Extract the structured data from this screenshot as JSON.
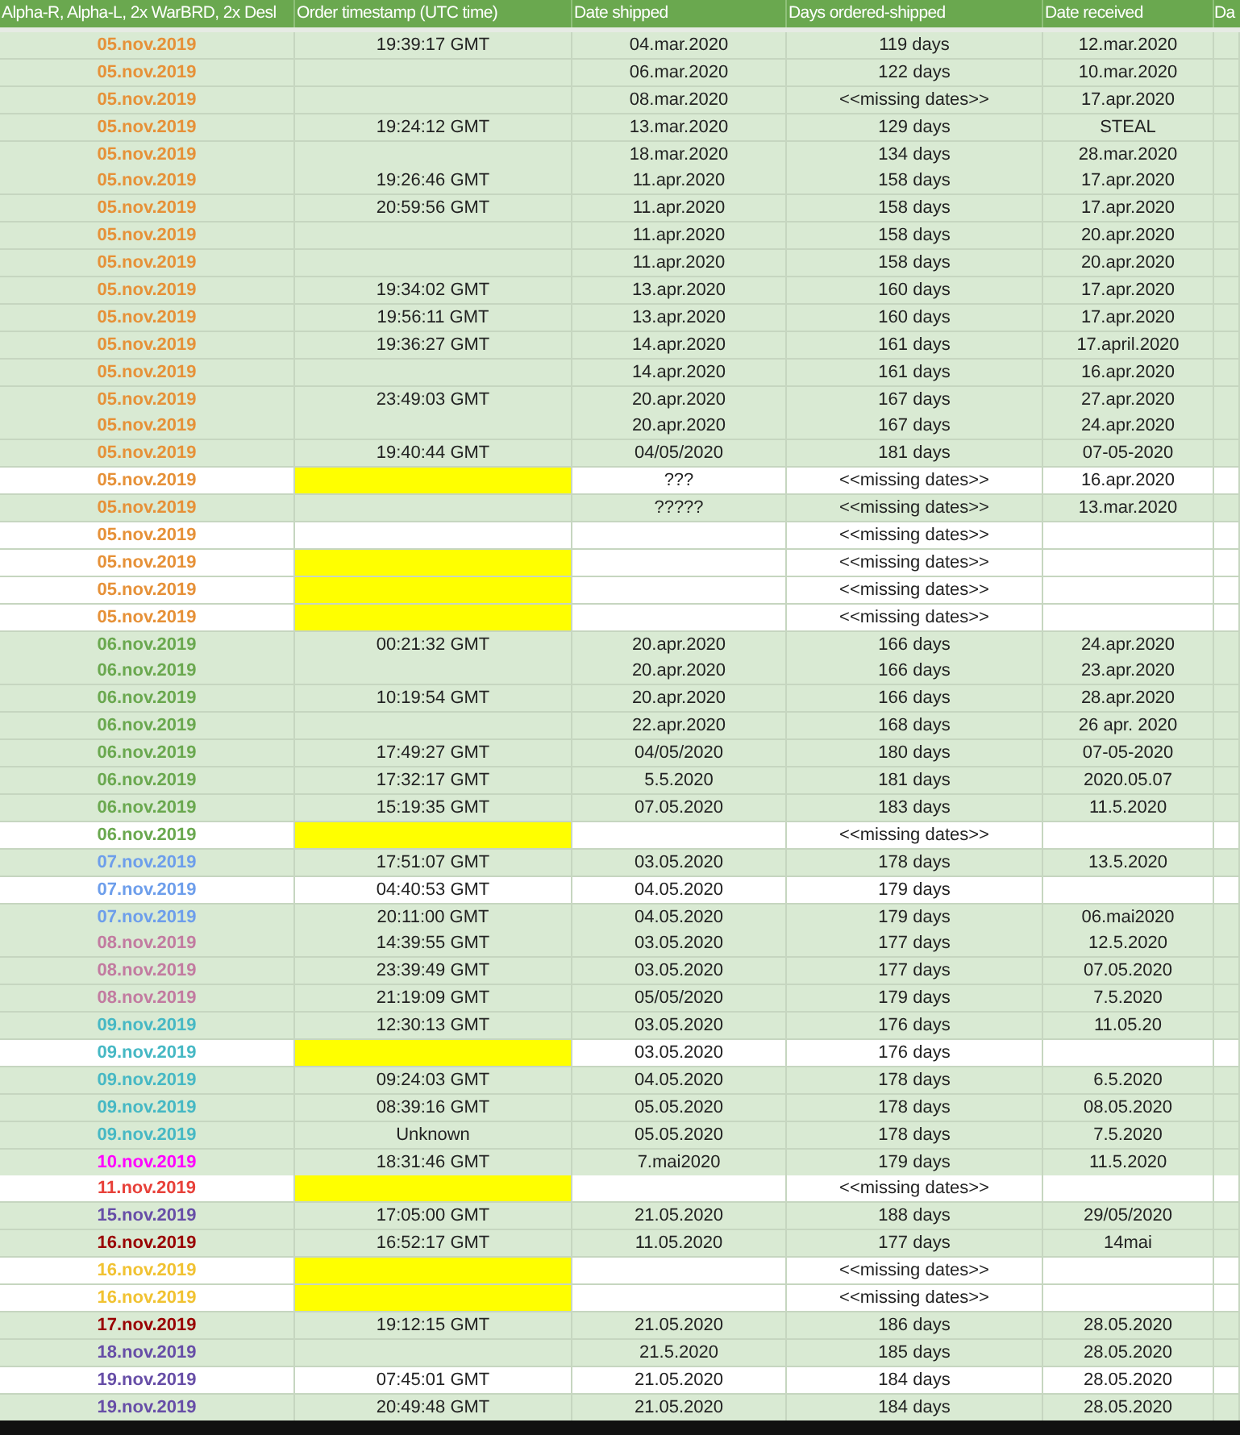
{
  "columns": [
    "Alpha-R, Alpha-L, 2x WarBRD, 2x Desl",
    "Order timestamp (UTC time)",
    "Date shipped",
    "Days ordered-shipped",
    "Date received",
    "Da"
  ],
  "rows": [
    {
      "kind": "green",
      "date": "05.nov.2019",
      "color": "#e69138",
      "time": "19:39:17 GMT",
      "flagged": false,
      "shipped": "04.mar.2020",
      "days": "119 days",
      "received": "12.mar.2020"
    },
    {
      "kind": "green",
      "date": "05.nov.2019",
      "color": "#e69138",
      "flagged": false,
      "shipped": "06.mar.2020",
      "days": "122 days",
      "received": "10.mar.2020"
    },
    {
      "kind": "green",
      "date": "05.nov.2019",
      "color": "#e69138",
      "flagged": false,
      "shipped": "08.mar.2020",
      "days": "<<missing dates>>",
      "received": "17.apr.2020"
    },
    {
      "kind": "green",
      "date": "05.nov.2019",
      "color": "#e69138",
      "time": "19:24:12 GMT",
      "flagged": false,
      "shipped": "13.mar.2020",
      "days": "129 days",
      "received": "STEAL"
    },
    {
      "kind": "green",
      "date": "05.nov.2019",
      "color": "#e69138",
      "flagged": false,
      "shipped": "18.mar.2020",
      "days": "134 days",
      "received": "28.mar.2020"
    },
    {
      "kind": "green",
      "date": "05.nov.2019",
      "color": "#e69138",
      "time": "19:26:46 GMT",
      "flagged": false,
      "shipped": "11.apr.2020",
      "days": "158 days",
      "received": "17.apr.2020"
    },
    {
      "kind": "green",
      "date": "05.nov.2019",
      "color": "#e69138",
      "time": "20:59:56 GMT",
      "flagged": false,
      "shipped": "11.apr.2020",
      "days": "158 days",
      "received": "17.apr.2020"
    },
    {
      "kind": "green",
      "date": "05.nov.2019",
      "color": "#e69138",
      "flagged": false,
      "shipped": "11.apr.2020",
      "days": "158 days",
      "received": "20.apr.2020"
    },
    {
      "kind": "green",
      "date": "05.nov.2019",
      "color": "#e69138",
      "flagged": false,
      "shipped": "11.apr.2020",
      "days": "158 days",
      "received": "20.apr.2020"
    },
    {
      "kind": "green",
      "date": "05.nov.2019",
      "color": "#e69138",
      "time": "19:34:02 GMT",
      "flagged": false,
      "shipped": "13.apr.2020",
      "days": "160 days",
      "received": "17.apr.2020"
    },
    {
      "kind": "green",
      "date": "05.nov.2019",
      "color": "#e69138",
      "time": "19:56:11 GMT",
      "flagged": false,
      "shipped": "13.apr.2020",
      "days": "160 days",
      "received": "17.apr.2020"
    },
    {
      "kind": "green",
      "date": "05.nov.2019",
      "color": "#e69138",
      "time": "19:36:27 GMT",
      "flagged": false,
      "shipped": "14.apr.2020",
      "days": "161 days",
      "received": "17.april.2020"
    },
    {
      "kind": "green",
      "date": "05.nov.2019",
      "color": "#e69138",
      "flagged": false,
      "shipped": "14.apr.2020",
      "days": "161 days",
      "received": "16.apr.2020"
    },
    {
      "kind": "green",
      "date": "05.nov.2019",
      "color": "#e69138",
      "time": "23:49:03 GMT",
      "flagged": false,
      "shipped": "20.apr.2020",
      "days": "167 days",
      "received": "27.apr.2020"
    },
    {
      "kind": "green",
      "date": "05.nov.2019",
      "color": "#e69138",
      "flagged": false,
      "shipped": "20.apr.2020",
      "days": "167 days",
      "received": "24.apr.2020"
    },
    {
      "kind": "green",
      "date": "05.nov.2019",
      "color": "#e69138",
      "time": "19:40:44 GMT",
      "flagged": false,
      "shipped": "04/05/2020",
      "days": "181 days",
      "received": "07-05-2020"
    },
    {
      "kind": "white",
      "date": "05.nov.2019",
      "color": "#e69138",
      "flagged": true,
      "shipped": "???",
      "days": "<<missing dates>>",
      "received": "16.apr.2020"
    },
    {
      "kind": "green",
      "date": "05.nov.2019",
      "color": "#e69138",
      "flagged": false,
      "shipped": "?????",
      "days": "<<missing dates>>",
      "received": "13.mar.2020"
    },
    {
      "kind": "white",
      "date": "05.nov.2019",
      "color": "#e69138",
      "flagged": false,
      "days": "<<missing dates>>"
    },
    {
      "kind": "white",
      "date": "05.nov.2019",
      "color": "#e69138",
      "flagged": true,
      "days": "<<missing dates>>"
    },
    {
      "kind": "white",
      "date": "05.nov.2019",
      "color": "#e69138",
      "flagged": true,
      "days": "<<missing dates>>"
    },
    {
      "kind": "white",
      "date": "05.nov.2019",
      "color": "#e69138",
      "flagged": true,
      "days": "<<missing dates>>"
    },
    {
      "kind": "green",
      "date": "06.nov.2019",
      "color": "#6aa84f",
      "time": "00:21:32 GMT",
      "flagged": false,
      "shipped": "20.apr.2020",
      "days": "166 days",
      "received": "24.apr.2020"
    },
    {
      "kind": "green",
      "date": "06.nov.2019",
      "color": "#6aa84f",
      "flagged": false,
      "shipped": "20.apr.2020",
      "days": "166 days",
      "received": "23.apr.2020"
    },
    {
      "kind": "green",
      "date": "06.nov.2019",
      "color": "#6aa84f",
      "time": "10:19:54 GMT",
      "flagged": false,
      "shipped": "20.apr.2020",
      "days": "166 days",
      "received": "28.apr.2020"
    },
    {
      "kind": "green",
      "date": "06.nov.2019",
      "color": "#6aa84f",
      "flagged": false,
      "shipped": "22.apr.2020",
      "days": "168 days",
      "received": "26 apr. 2020"
    },
    {
      "kind": "green",
      "date": "06.nov.2019",
      "color": "#6aa84f",
      "time": "17:49:27 GMT",
      "flagged": false,
      "shipped": "04/05/2020",
      "days": "180 days",
      "received": "07-05-2020"
    },
    {
      "kind": "green",
      "date": "06.nov.2019",
      "color": "#6aa84f",
      "time": "17:32:17 GMT",
      "flagged": false,
      "shipped": "5.5.2020",
      "days": "181 days",
      "received": "2020.05.07"
    },
    {
      "kind": "green",
      "date": "06.nov.2019",
      "color": "#6aa84f",
      "time": "15:19:35 GMT",
      "flagged": false,
      "shipped": "07.05.2020",
      "days": "183 days",
      "received": "11.5.2020"
    },
    {
      "kind": "white",
      "date": "06.nov.2019",
      "color": "#6aa84f",
      "flagged": true,
      "days": "<<missing dates>>"
    },
    {
      "kind": "green",
      "date": "07.nov.2019",
      "color": "#6d9eeb",
      "time": "17:51:07 GMT",
      "flagged": false,
      "shipped": "03.05.2020",
      "days": "178 days",
      "received": "13.5.2020"
    },
    {
      "kind": "white",
      "date": "07.nov.2019",
      "color": "#6d9eeb",
      "time": "04:40:53 GMT",
      "flagged": false,
      "shipped": "04.05.2020",
      "days": "179 days"
    },
    {
      "kind": "green",
      "date": "07.nov.2019",
      "color": "#6d9eeb",
      "time": "20:11:00 GMT",
      "flagged": false,
      "shipped": "04.05.2020",
      "days": "179 days",
      "received": "06.mai2020"
    },
    {
      "kind": "green",
      "date": "08.nov.2019",
      "color": "#c27ba0",
      "time": "14:39:55 GMT",
      "flagged": false,
      "shipped": "03.05.2020",
      "days": "177 days",
      "received": "12.5.2020"
    },
    {
      "kind": "green",
      "date": "08.nov.2019",
      "color": "#c27ba0",
      "time": "23:39:49 GMT",
      "flagged": false,
      "shipped": "03.05.2020",
      "days": "177 days",
      "received": "07.05.2020"
    },
    {
      "kind": "green",
      "date": "08.nov.2019",
      "color": "#c27ba0",
      "time": "21:19:09 GMT",
      "flagged": false,
      "shipped": "05/05/2020",
      "days": "179 days",
      "received": "7.5.2020"
    },
    {
      "kind": "green",
      "date": "09.nov.2019",
      "color": "#46b8c4",
      "time": "12:30:13 GMT",
      "flagged": false,
      "shipped": "03.05.2020",
      "days": "176 days",
      "received": "11.05.20"
    },
    {
      "kind": "white",
      "date": "09.nov.2019",
      "color": "#46b8c4",
      "flagged": true,
      "shipped": "03.05.2020",
      "days": "176 days"
    },
    {
      "kind": "green",
      "date": "09.nov.2019",
      "color": "#46b8c4",
      "time": "09:24:03 GMT",
      "flagged": false,
      "shipped": "04.05.2020",
      "days": "178 days",
      "received": "6.5.2020"
    },
    {
      "kind": "green",
      "date": "09.nov.2019",
      "color": "#46b8c4",
      "time": "08:39:16 GMT",
      "flagged": false,
      "shipped": "05.05.2020",
      "days": "178 days",
      "received": "08.05.2020"
    },
    {
      "kind": "green",
      "date": "09.nov.2019",
      "color": "#46b8c4",
      "time": "Unknown",
      "flagged": false,
      "shipped": "05.05.2020",
      "days": "178 days",
      "received": "7.5.2020"
    },
    {
      "kind": "green",
      "date": "10.nov.2019",
      "color": "#ff00ff",
      "time": "18:31:46 GMT",
      "flagged": false,
      "shipped": "7.mai2020",
      "days": "179 days",
      "received": "11.5.2020"
    },
    {
      "kind": "white",
      "date": "11.nov.2019",
      "color": "#e8413a",
      "flagged": true,
      "days": "<<missing dates>>"
    },
    {
      "kind": "green",
      "date": "15.nov.2019",
      "color": "#674ea7",
      "time": "17:05:00 GMT",
      "flagged": false,
      "shipped": "21.05.2020",
      "days": "188 days",
      "received": "29/05/2020"
    },
    {
      "kind": "green",
      "date": "16.nov.2019",
      "color": "#990000",
      "time": "16:52:17 GMT",
      "flagged": false,
      "shipped": "11.05.2020",
      "days": "177 days",
      "received": "14mai"
    },
    {
      "kind": "white",
      "date": "16.nov.2019",
      "color": "#f1c232",
      "flagged": true,
      "days": "<<missing dates>>"
    },
    {
      "kind": "white",
      "date": "16.nov.2019",
      "color": "#f1c232",
      "flagged": true,
      "days": "<<missing dates>>"
    },
    {
      "kind": "green",
      "date": "17.nov.2019",
      "color": "#990000",
      "time": "19:12:15 GMT",
      "flagged": false,
      "shipped": "21.05.2020",
      "days": "186 days",
      "received": "28.05.2020"
    },
    {
      "kind": "green",
      "date": "18.nov.2019",
      "color": "#674ea7",
      "flagged": false,
      "shipped": "21.5.2020",
      "days": "185 days",
      "received": "28.05.2020"
    },
    {
      "kind": "white",
      "date": "19.nov.2019",
      "color": "#674ea7",
      "time": "07:45:01 GMT",
      "flagged": false,
      "shipped": "21.05.2020",
      "days": "184 days",
      "received": "28.05.2020"
    },
    {
      "kind": "green",
      "date": "19.nov.2019",
      "color": "#674ea7",
      "time": "20:49:48 GMT",
      "flagged": false,
      "shipped": "21.05.2020",
      "days": "184 days",
      "received": "28.05.2020"
    }
  ]
}
